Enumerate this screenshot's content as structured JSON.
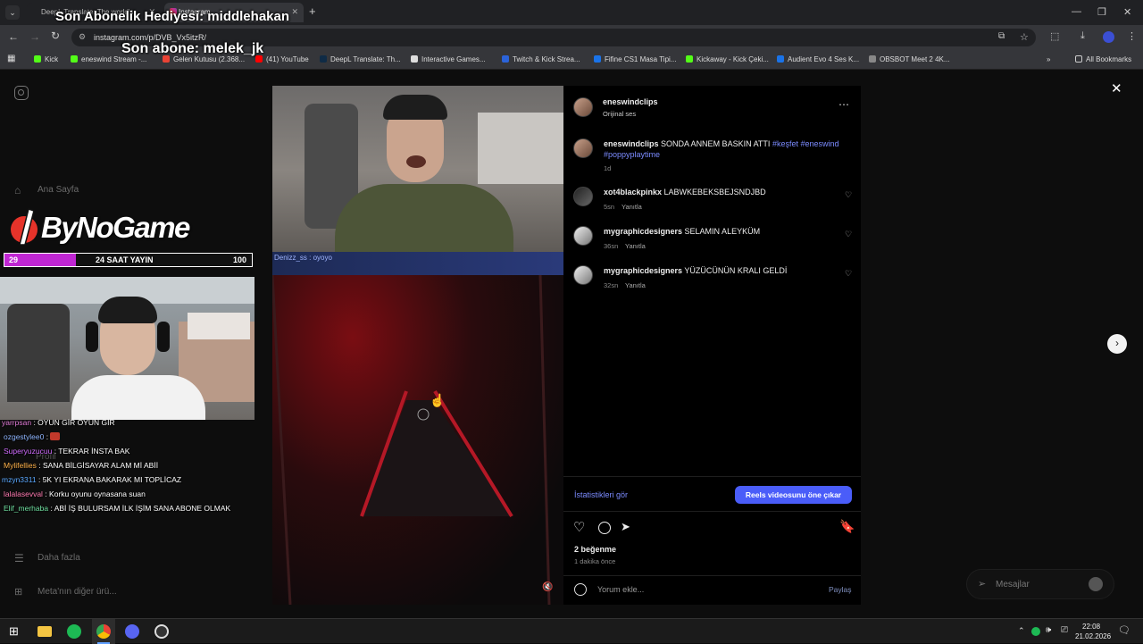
{
  "browser": {
    "tabs": [
      {
        "title": "DeepL Translate: The world's"
      },
      {
        "title": "Instagram"
      }
    ],
    "url": "instagram.com/p/DVB_Vx5itzR/",
    "bookmarks": [
      "Kick",
      "eneswind Stream -...",
      "Gelen Kutusu (2.368...",
      "(41) YouTube",
      "DeepL Translate: Th...",
      "Interactive Games...",
      "Twitch & Kick Strea...",
      "Fifine CS1 Masa Tipi...",
      "Kickaway - Kick Çeki...",
      "Audient Evo 4 Ses K...",
      "OBSBOT Meet 2 4K..."
    ],
    "all_bookmarks": "All Bookmarks"
  },
  "overlay": {
    "gift_text": "Son Abonelik Hediyesi: middlehakan",
    "sub_text": "Son abone: melek_jk",
    "brand": "ByNoGame",
    "bar_left": "29",
    "bar_label": "24 SAAT YAYIN",
    "bar_right": "100",
    "bar_progress": 0.29,
    "chat": [
      {
        "user": "yarrpsan",
        "msg": "OYUN GİR OYUN GİR",
        "color": "#e07bd6"
      },
      {
        "user": "ozgestylee0",
        "msg": "",
        "color": "#8fb6ff"
      },
      {
        "user": "Superyuzucuu",
        "msg": "TEKRAR İNSTA BAK",
        "color": "#d06bff"
      },
      {
        "user": "Mylifellies",
        "msg": "SANA BİLGİSAYAR ALAM Mİ ABİİ",
        "color": "#ffb24a"
      },
      {
        "user": "mzyn3311",
        "msg": "5K YI EKRANA BAKARAK MI TOPLİCAZ",
        "color": "#5aa8ff"
      },
      {
        "user": "lalalasevval",
        "msg": "Korku oyunu oynasana suan",
        "color": "#ff7ab0"
      },
      {
        "user": "Elif_merhaba",
        "msg": "ABİ İŞ BULURSAM İLK İŞİM SANA ABONE OLMAK",
        "color": "#6fe0a0"
      }
    ]
  },
  "instagram": {
    "nav": {
      "home": "Ana Sayfa",
      "profile": "Profil",
      "more": "Daha fazla",
      "meta": "Meta'nın diğer ürü..."
    },
    "post": {
      "author": "eneswindclips",
      "audio": "Orijinal ses",
      "caption_user": "eneswindclips",
      "caption_text": "SONDA ANNEM BASKIN ATTI",
      "caption_tags": "#keşfet #eneswind",
      "caption_tags2": "#poppyplaytime",
      "caption_time": "1d",
      "comments": [
        {
          "user": "xot4blackpinkx",
          "text": "LABWKEBEKSBEJSNDJBD",
          "time": "5sn",
          "reply": "Yanıtla"
        },
        {
          "user": "mygraphicdesigners",
          "text": "SELAMIN ALEYKÜM",
          "time": "36sn",
          "reply": "Yanıtla"
        },
        {
          "user": "mygraphicdesigners",
          "text": "YÜZÜCÜNÜN KRALI GELDİ",
          "time": "32sn",
          "reply": "Yanıtla"
        }
      ],
      "insights": "İstatistikleri gör",
      "boost": "Reels videosunu öne çıkar",
      "likes": "2 beğenme",
      "posted": "1 dakika önce",
      "comment_placeholder": "Yorum ekle...",
      "share": "Paylaş",
      "video_caption_1": "Denizz_ss : oyoyo"
    },
    "messages": "Mesajlar"
  },
  "taskbar": {
    "time": "22:08",
    "date": "21.02.2026"
  },
  "colors": {
    "accent": "#4a5df9",
    "link": "#7b8bff",
    "brand_pink": "#c026d3"
  }
}
